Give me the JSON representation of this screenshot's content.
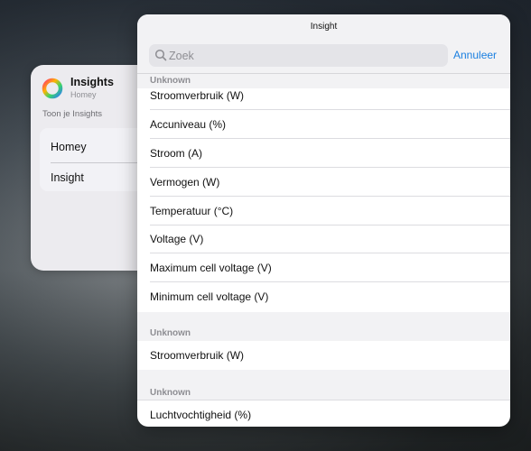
{
  "widget": {
    "title": "Insights",
    "subtitle": "Homey",
    "hint": "Toon je Insights",
    "items": [
      "Homey",
      "Insight"
    ]
  },
  "sheet": {
    "title": "Insight",
    "search": {
      "placeholder": "Zoek",
      "value": ""
    },
    "cancel_label": "Annuleer",
    "sections": [
      {
        "label": "Unknown",
        "items": [
          "Stroomverbruik (W)",
          "Accuniveau (%)",
          "Stroom (A)",
          "Vermogen (W)",
          "Temperatuur (°C)",
          "Voltage (V)",
          "Maximum cell voltage (V)",
          "Minimum cell voltage (V)"
        ]
      },
      {
        "label": "Unknown",
        "items": [
          "Stroomverbruik (W)"
        ]
      },
      {
        "label": "Unknown",
        "items": [
          "Luchtvochtigheid (%)"
        ]
      }
    ]
  },
  "colors": {
    "accent": "#1a7fe0",
    "section_text": "#8e8e93"
  }
}
